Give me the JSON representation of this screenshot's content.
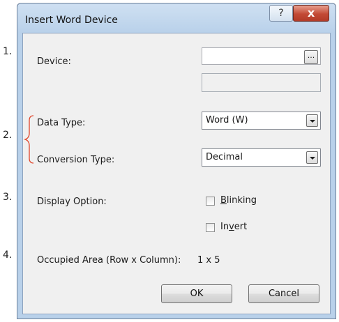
{
  "markers": [
    "1.",
    "2.",
    "3.",
    "4."
  ],
  "dialog": {
    "title": "Insert Word Device",
    "help_glyph": "?",
    "close_glyph": "x"
  },
  "device": {
    "label": "Device:",
    "value": "",
    "browse_label": "...",
    "info_value": ""
  },
  "data_type": {
    "label": "Data Type:",
    "selected": "Word (W)"
  },
  "conversion_type": {
    "label": "Conversion Type:",
    "selected": "Decimal"
  },
  "display_option": {
    "label": "Display Option:",
    "blinking": {
      "pre": "",
      "accel": "B",
      "post": "linking",
      "checked": false
    },
    "invert": {
      "pre": "In",
      "accel": "v",
      "post": "ert",
      "checked": false
    }
  },
  "occupied_area": {
    "label": "Occupied Area (Row x Column):",
    "value": "1 x 5"
  },
  "buttons": {
    "ok": "OK",
    "cancel": "Cancel"
  },
  "colors": {
    "title_bar": "#b9d1ea",
    "client_bg": "#f0f0f0",
    "close_button": "#c34a36",
    "annotation_brace": "#e0452b"
  },
  "icons": [
    "help-icon",
    "close-icon",
    "dropdown-arrow-icon"
  ]
}
